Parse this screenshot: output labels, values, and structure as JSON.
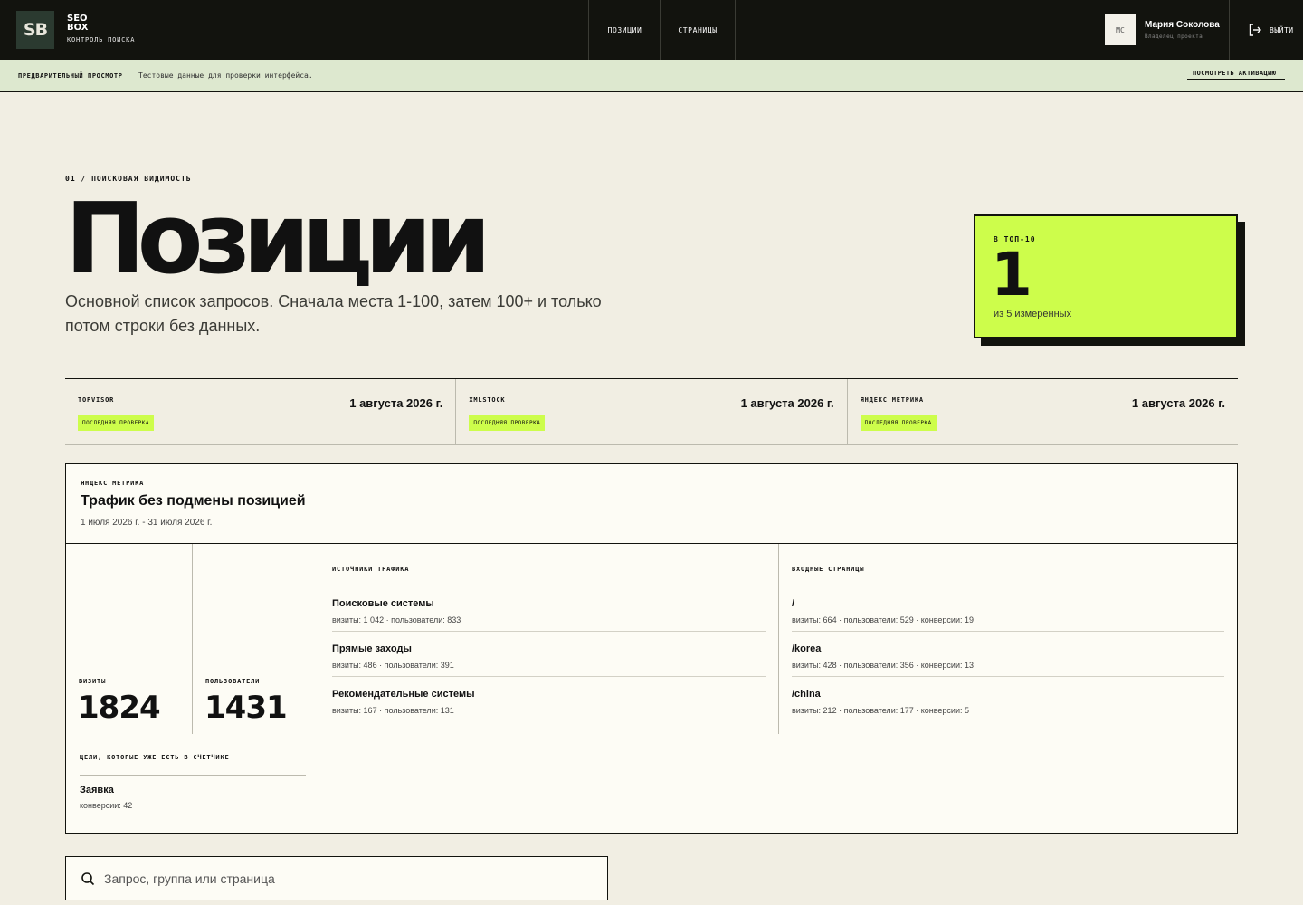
{
  "header": {
    "logo": "SB",
    "brand_name": "SEO BOX",
    "brand_sub": "КОНТРОЛЬ ПОИСКА",
    "nav": [
      {
        "label": "ПОЗИЦИИ"
      },
      {
        "label": "СТРАНИЦЫ"
      }
    ],
    "user": {
      "initials": "МС",
      "name": "Мария Соколова",
      "role": "Владелец проекта"
    },
    "logout_label": "ВЫЙТИ"
  },
  "banner": {
    "title": "ПРЕДВАРИТЕЛЬНЫЙ ПРОСМОТР",
    "text": "Тестовые данные для проверки интерфейса.",
    "link": "ПОСМОТРЕТЬ АКТИВАЦИЮ"
  },
  "page": {
    "eyebrow": "01 / ПОИСКОВАЯ ВИДИМОСТЬ",
    "title": "Позиции",
    "subtitle": "Основной список запросов. Сначала места 1-100, затем 100+ и только потом строки без данных."
  },
  "top10": {
    "label": "В ТОП-10",
    "value": "1",
    "note": "из 5 измеренных"
  },
  "sources": [
    {
      "name": "TOPVISOR",
      "tag": "ПОСЛЕДНЯЯ ПРОВЕРКА",
      "date": "1 августа 2026 г."
    },
    {
      "name": "XMLSTOCK",
      "tag": "ПОСЛЕДНЯЯ ПРОВЕРКА",
      "date": "1 августа 2026 г."
    },
    {
      "name": "ЯНДЕКС МЕТРИКА",
      "tag": "ПОСЛЕДНЯЯ ПРОВЕРКА",
      "date": "1 августа 2026 г."
    }
  ],
  "metrika": {
    "eyebrow": "ЯНДЕКС МЕТРИКА",
    "title": "Трафик без подмены позицией",
    "period": "1 июля 2026 г. - 31 июля 2026 г.",
    "visits": {
      "label": "ВИЗИТЫ",
      "value": "1824"
    },
    "users": {
      "label": "ПОЛЬЗОВАТЕЛИ",
      "value": "1431"
    },
    "traffic_sources": {
      "title": "ИСТОЧНИКИ ТРАФИКА",
      "items": [
        {
          "name": "Поисковые системы",
          "meta": "визиты: 1 042 · пользователи: 833"
        },
        {
          "name": "Прямые заходы",
          "meta": "визиты: 486 · пользователи: 391"
        },
        {
          "name": "Рекомендательные системы",
          "meta": "визиты: 167 · пользователи: 131"
        }
      ]
    },
    "entry_pages": {
      "title": "ВХОДНЫЕ СТРАНИЦЫ",
      "items": [
        {
          "name": "/",
          "meta": "визиты: 664 · пользователи: 529 · конверсии: 19"
        },
        {
          "name": "/korea",
          "meta": "визиты: 428 · пользователи: 356 · конверсии: 13"
        },
        {
          "name": "/china",
          "meta": "визиты: 212 · пользователи: 177 · конверсии: 5"
        }
      ]
    },
    "goals": {
      "title": "ЦЕЛИ, КОТОРЫЕ УЖЕ ЕСТЬ В СЧЕТЧИКЕ",
      "items": [
        {
          "name": "Заявка",
          "meta": "конверсии: 42"
        }
      ]
    }
  },
  "search": {
    "placeholder": "Запрос, группа или страница",
    "value": ""
  }
}
